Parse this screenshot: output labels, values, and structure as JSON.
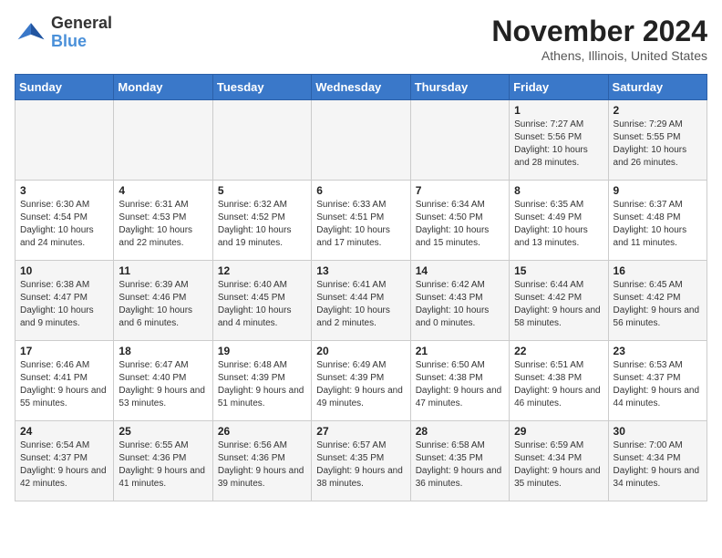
{
  "header": {
    "logo_line1": "General",
    "logo_line2": "Blue",
    "title": "November 2024",
    "subtitle": "Athens, Illinois, United States"
  },
  "weekdays": [
    "Sunday",
    "Monday",
    "Tuesday",
    "Wednesday",
    "Thursday",
    "Friday",
    "Saturday"
  ],
  "weeks": [
    [
      {
        "day": "",
        "info": ""
      },
      {
        "day": "",
        "info": ""
      },
      {
        "day": "",
        "info": ""
      },
      {
        "day": "",
        "info": ""
      },
      {
        "day": "",
        "info": ""
      },
      {
        "day": "1",
        "info": "Sunrise: 7:27 AM\nSunset: 5:56 PM\nDaylight: 10 hours\nand 28 minutes."
      },
      {
        "day": "2",
        "info": "Sunrise: 7:29 AM\nSunset: 5:55 PM\nDaylight: 10 hours\nand 26 minutes."
      }
    ],
    [
      {
        "day": "3",
        "info": "Sunrise: 6:30 AM\nSunset: 4:54 PM\nDaylight: 10 hours\nand 24 minutes."
      },
      {
        "day": "4",
        "info": "Sunrise: 6:31 AM\nSunset: 4:53 PM\nDaylight: 10 hours\nand 22 minutes."
      },
      {
        "day": "5",
        "info": "Sunrise: 6:32 AM\nSunset: 4:52 PM\nDaylight: 10 hours\nand 19 minutes."
      },
      {
        "day": "6",
        "info": "Sunrise: 6:33 AM\nSunset: 4:51 PM\nDaylight: 10 hours\nand 17 minutes."
      },
      {
        "day": "7",
        "info": "Sunrise: 6:34 AM\nSunset: 4:50 PM\nDaylight: 10 hours\nand 15 minutes."
      },
      {
        "day": "8",
        "info": "Sunrise: 6:35 AM\nSunset: 4:49 PM\nDaylight: 10 hours\nand 13 minutes."
      },
      {
        "day": "9",
        "info": "Sunrise: 6:37 AM\nSunset: 4:48 PM\nDaylight: 10 hours\nand 11 minutes."
      }
    ],
    [
      {
        "day": "10",
        "info": "Sunrise: 6:38 AM\nSunset: 4:47 PM\nDaylight: 10 hours\nand 9 minutes."
      },
      {
        "day": "11",
        "info": "Sunrise: 6:39 AM\nSunset: 4:46 PM\nDaylight: 10 hours\nand 6 minutes."
      },
      {
        "day": "12",
        "info": "Sunrise: 6:40 AM\nSunset: 4:45 PM\nDaylight: 10 hours\nand 4 minutes."
      },
      {
        "day": "13",
        "info": "Sunrise: 6:41 AM\nSunset: 4:44 PM\nDaylight: 10 hours\nand 2 minutes."
      },
      {
        "day": "14",
        "info": "Sunrise: 6:42 AM\nSunset: 4:43 PM\nDaylight: 10 hours\nand 0 minutes."
      },
      {
        "day": "15",
        "info": "Sunrise: 6:44 AM\nSunset: 4:42 PM\nDaylight: 9 hours\nand 58 minutes."
      },
      {
        "day": "16",
        "info": "Sunrise: 6:45 AM\nSunset: 4:42 PM\nDaylight: 9 hours\nand 56 minutes."
      }
    ],
    [
      {
        "day": "17",
        "info": "Sunrise: 6:46 AM\nSunset: 4:41 PM\nDaylight: 9 hours\nand 55 minutes."
      },
      {
        "day": "18",
        "info": "Sunrise: 6:47 AM\nSunset: 4:40 PM\nDaylight: 9 hours\nand 53 minutes."
      },
      {
        "day": "19",
        "info": "Sunrise: 6:48 AM\nSunset: 4:39 PM\nDaylight: 9 hours\nand 51 minutes."
      },
      {
        "day": "20",
        "info": "Sunrise: 6:49 AM\nSunset: 4:39 PM\nDaylight: 9 hours\nand 49 minutes."
      },
      {
        "day": "21",
        "info": "Sunrise: 6:50 AM\nSunset: 4:38 PM\nDaylight: 9 hours\nand 47 minutes."
      },
      {
        "day": "22",
        "info": "Sunrise: 6:51 AM\nSunset: 4:38 PM\nDaylight: 9 hours\nand 46 minutes."
      },
      {
        "day": "23",
        "info": "Sunrise: 6:53 AM\nSunset: 4:37 PM\nDaylight: 9 hours\nand 44 minutes."
      }
    ],
    [
      {
        "day": "24",
        "info": "Sunrise: 6:54 AM\nSunset: 4:37 PM\nDaylight: 9 hours\nand 42 minutes."
      },
      {
        "day": "25",
        "info": "Sunrise: 6:55 AM\nSunset: 4:36 PM\nDaylight: 9 hours\nand 41 minutes."
      },
      {
        "day": "26",
        "info": "Sunrise: 6:56 AM\nSunset: 4:36 PM\nDaylight: 9 hours\nand 39 minutes."
      },
      {
        "day": "27",
        "info": "Sunrise: 6:57 AM\nSunset: 4:35 PM\nDaylight: 9 hours\nand 38 minutes."
      },
      {
        "day": "28",
        "info": "Sunrise: 6:58 AM\nSunset: 4:35 PM\nDaylight: 9 hours\nand 36 minutes."
      },
      {
        "day": "29",
        "info": "Sunrise: 6:59 AM\nSunset: 4:34 PM\nDaylight: 9 hours\nand 35 minutes."
      },
      {
        "day": "30",
        "info": "Sunrise: 7:00 AM\nSunset: 4:34 PM\nDaylight: 9 hours\nand 34 minutes."
      }
    ]
  ]
}
